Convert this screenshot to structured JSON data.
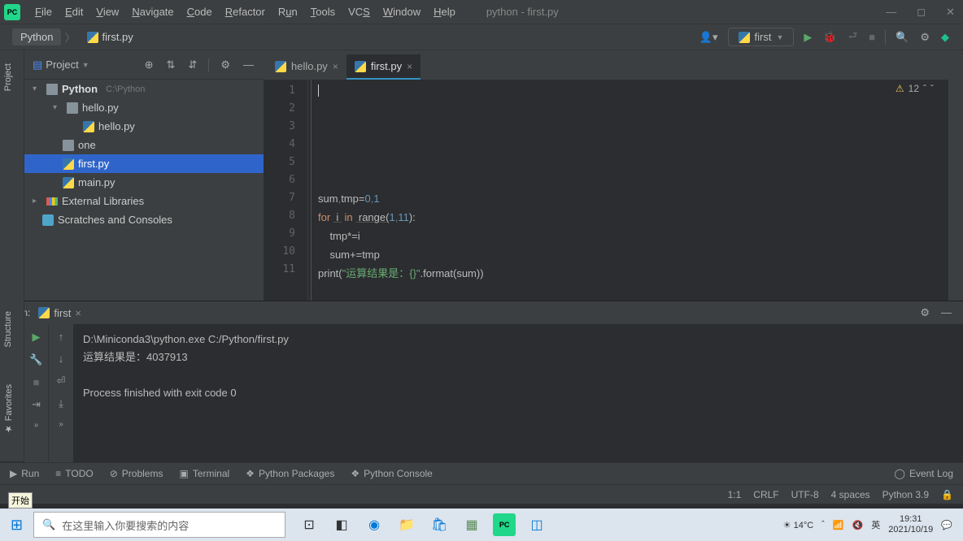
{
  "window": {
    "title": "python - first.py"
  },
  "menu": [
    "File",
    "Edit",
    "View",
    "Navigate",
    "Code",
    "Refactor",
    "Run",
    "Tools",
    "VCS",
    "Window",
    "Help"
  ],
  "breadcrumb": {
    "root": "Python",
    "file": "first.py"
  },
  "runconfig": {
    "name": "first"
  },
  "project": {
    "title": "Project",
    "root": {
      "name": "Python",
      "path": "C:\\Python"
    },
    "tree": [
      {
        "indent": 1,
        "arrow": "▾",
        "icon": "folder",
        "label": "hello.py"
      },
      {
        "indent": 2,
        "arrow": "",
        "icon": "py",
        "label": "hello.py"
      },
      {
        "indent": 1,
        "arrow": "",
        "icon": "folder",
        "label": "one"
      },
      {
        "indent": 1,
        "arrow": "",
        "icon": "py",
        "label": "first.py",
        "sel": true
      },
      {
        "indent": 1,
        "arrow": "",
        "icon": "py",
        "label": "main.py"
      }
    ],
    "ext": "External Libraries",
    "scratch": "Scratches and Consoles"
  },
  "tabs": [
    {
      "name": "hello.py",
      "active": false
    },
    {
      "name": "first.py",
      "active": true
    }
  ],
  "inspection": {
    "count": "12"
  },
  "code": {
    "lines": [
      "1",
      "2",
      "3",
      "4",
      "5",
      "6",
      "7",
      "8",
      "9",
      "10",
      "11"
    ],
    "l5a": "sum",
    "l5b": ",",
    "l5c": "tmp",
    "l5d": "=",
    "l5e": "0",
    "l5f": ",",
    "l5g": "1",
    "l6a": "for ",
    "l6b": " i ",
    "l6c": " in ",
    "l6d": " range(",
    "l6e": "1",
    "l6f": ",",
    "l6g": "11",
    "l6h": "):",
    "l7": "    tmp*=i",
    "l8": "    sum+=tmp",
    "l9a": "print(",
    "l9b": "\"运算结果是：{}\"",
    "l9c": ".format(sum))"
  },
  "run": {
    "label": "Run:",
    "config": "first",
    "out1": "D:\\Miniconda3\\python.exe C:/Python/first.py",
    "out2": "运算结果是：4037913",
    "out3": "Process finished with exit code 0"
  },
  "bottom": {
    "run": "Run",
    "todo": "TODO",
    "problems": "Problems",
    "terminal": "Terminal",
    "packages": "Python Packages",
    "console": "Python Console",
    "eventlog": "Event Log"
  },
  "status": {
    "pos": "1:1",
    "le": "CRLF",
    "enc": "UTF-8",
    "indent": "4 spaces",
    "interp": "Python 3.9"
  },
  "sidetabs": {
    "project": "Project",
    "structure": "Structure",
    "favorites": "Favorites"
  },
  "taskbar": {
    "start_tooltip": "开始",
    "search": "在这里输入你要搜索的内容",
    "temp": "14°C",
    "ime": "英",
    "time": "19:31",
    "date": "2021/10/19"
  }
}
